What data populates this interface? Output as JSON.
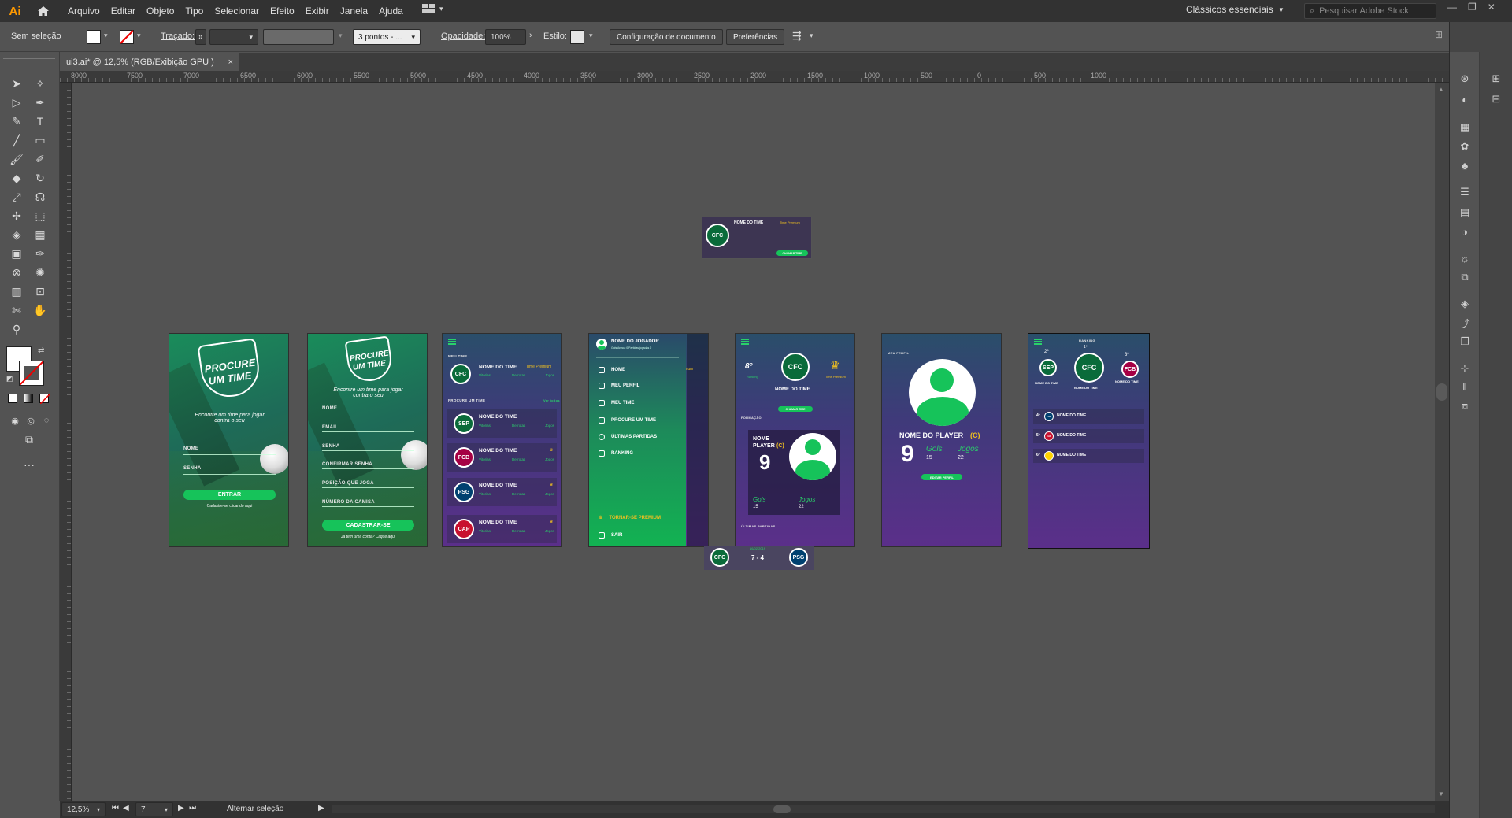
{
  "menubar": {
    "app_logo": "Ai",
    "items": [
      "Arquivo",
      "Editar",
      "Objeto",
      "Tipo",
      "Selecionar",
      "Efeito",
      "Exibir",
      "Janela",
      "Ajuda"
    ],
    "workspace": "Clássicos essenciais",
    "search_placeholder": "Pesquisar Adobe Stock"
  },
  "controlbar": {
    "selection": "Sem seleção",
    "stroke_label": "Traçado:",
    "brush": "3 pontos - ...",
    "opacity_label": "Opacidade:",
    "opacity_value": "100%",
    "style_label": "Estilo:",
    "doc_setup": "Configuração de documento",
    "preferences": "Preferências"
  },
  "document": {
    "tab_title": "ui3.ai* @ 12,5% (RGB/Exibição GPU )",
    "close": "×"
  },
  "ruler": {
    "ticks": [
      "8000",
      "7500",
      "7000",
      "6500",
      "6000",
      "5500",
      "5000",
      "4500",
      "4000",
      "3500",
      "3000",
      "2500",
      "2000",
      "1500",
      "1000",
      "500",
      "0",
      "500",
      "1000"
    ]
  },
  "statusbar": {
    "zoom": "12,5%",
    "artboard_num": "7",
    "toggle": "Alternar seleção"
  },
  "artboards": {
    "login": {
      "logo_line1": "PROCURE",
      "logo_line2": "UM TIME",
      "tagline": "Encontre um time para jogar contra o seu",
      "field_nome": "NOME",
      "field_senha": "SENHA",
      "button": "ENTRAR",
      "footer": "Cadastre-se clicando aqui"
    },
    "register": {
      "logo_line1": "PROCURE",
      "logo_line2": "UM TIME",
      "tagline": "Encontre um time para jogar contra o seu",
      "fields": [
        "NOME",
        "EMAIL",
        "SENHA",
        "CONFIRMAR SENHA",
        "POSIÇÃO QUE JOGA",
        "NÚMERO DA CAMISA"
      ],
      "button": "CADASTRAR-SE",
      "footer": "Já tem uma conta? Clique aqui"
    },
    "teams": {
      "section1": "MEU TIME",
      "section2": "PROCURE UM TIME",
      "see_all": "Ver todos",
      "premium": "Time Premium",
      "team_name": "NOME DO TIME",
      "stats": [
        "Vitórias",
        "Derrotas",
        "Jogos"
      ],
      "rows": [
        {
          "crest": "CFC",
          "color": "#0a6b3a",
          "premium": true
        },
        {
          "crest": "SEP",
          "color": "#0a6b3a",
          "premium": false
        },
        {
          "crest": "FCB",
          "color": "#a50044",
          "premium": true
        },
        {
          "crest": "PSG",
          "color": "#004170",
          "premium": true
        },
        {
          "crest": "CAP",
          "color": "#c8102e",
          "premium": true
        }
      ]
    },
    "menu": {
      "player": "NOME DO JOGADOR",
      "sub": "Gols Armou 0    Partidas jogadas 0",
      "items": [
        "HOME",
        "MEU PERFIL",
        "MEU TIME",
        "PROCURE UM TIME",
        "ÚLTIMAS PARTIDAS",
        "RANKING"
      ],
      "premium": "TORNAR-SE PREMIUM",
      "logout": "SAIR",
      "bg_premium": "Time Premium",
      "bg_team": "NOME DO TIME"
    },
    "team_detail": {
      "rank": "8º",
      "rank_label": "Ranking",
      "premium_label": "Time Premium",
      "team_name": "NOME DO TIME",
      "button": "CHAMAR TIME",
      "formation": "FORMAÇÃO",
      "player_label_1": "NOME",
      "player_label_2": "PLAYER",
      "captain": "(C)",
      "number": "9",
      "gols_label": "Gols",
      "gols": "15",
      "jogos_label": "Jogos",
      "jogos": "22",
      "last_matches": "ÚLTIMAS PARTIDAS",
      "match_date": "16/02/2019",
      "score": "7 - 4"
    },
    "popup": {
      "team_name": "NOME DO TIME",
      "premium": "Time Premium",
      "button": "CHAMAR TIME"
    },
    "profile": {
      "title": "MEU PERFIL",
      "name": "NOME DO PLAYER",
      "captain": "(C)",
      "number": "9",
      "gols_label": "Gols",
      "gols": "15",
      "jogos_label": "Jogos",
      "jogos": "22",
      "button": "EDITAR PERFIL"
    },
    "ranking": {
      "title": "RANKING",
      "first": "1º",
      "second": "2º",
      "third": "3º",
      "team_name": "NOME DO TIME",
      "rows": [
        {
          "pos": "4º",
          "name": "NOME DO TIME",
          "color": "#004170"
        },
        {
          "pos": "5º",
          "name": "NOME DO TIME",
          "color": "#c8102e"
        },
        {
          "pos": "6º",
          "name": "NOME DO TIME",
          "color": "#ffd200"
        }
      ]
    }
  }
}
